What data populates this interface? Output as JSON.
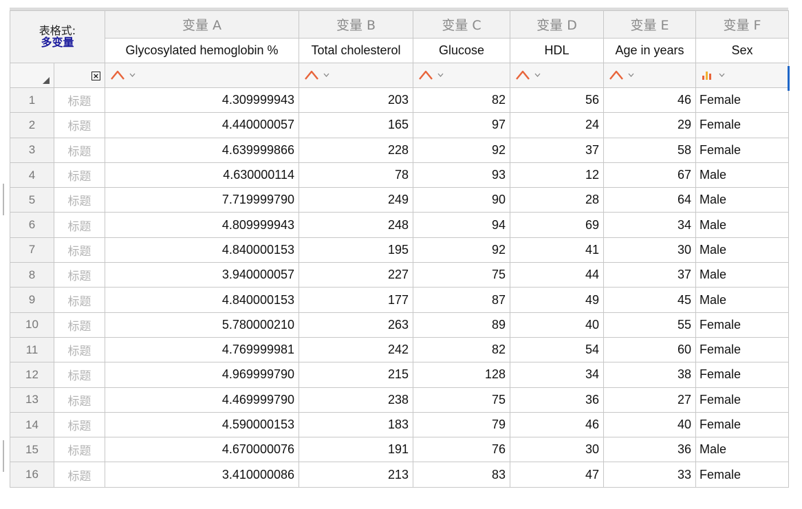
{
  "table_format": {
    "label": "表格式:",
    "value": "多变量"
  },
  "columns": [
    {
      "title": "变量 A",
      "name": "Glycosylated hemoglobin %",
      "type_icon": "continuous-distribution-icon"
    },
    {
      "title": "变量 B",
      "name": "Total cholesterol",
      "type_icon": "continuous-distribution-icon"
    },
    {
      "title": "变量 C",
      "name": "Glucose",
      "type_icon": "continuous-distribution-icon"
    },
    {
      "title": "变量 D",
      "name": "HDL",
      "type_icon": "continuous-distribution-icon"
    },
    {
      "title": "变量 E",
      "name": "Age in years",
      "type_icon": "continuous-distribution-icon"
    },
    {
      "title": "变量 F",
      "name": "Sex",
      "type_icon": "categorical-bar-icon"
    }
  ],
  "row_title_placeholder": "标题",
  "rows": [
    {
      "num": "1",
      "values": [
        "4.309999943",
        "203",
        "82",
        "56",
        "46",
        "Female"
      ]
    },
    {
      "num": "2",
      "values": [
        "4.440000057",
        "165",
        "97",
        "24",
        "29",
        "Female"
      ]
    },
    {
      "num": "3",
      "values": [
        "4.639999866",
        "228",
        "92",
        "37",
        "58",
        "Female"
      ]
    },
    {
      "num": "4",
      "values": [
        "4.630000114",
        "78",
        "93",
        "12",
        "67",
        "Male"
      ]
    },
    {
      "num": "5",
      "values": [
        "7.719999790",
        "249",
        "90",
        "28",
        "64",
        "Male"
      ]
    },
    {
      "num": "6",
      "values": [
        "4.809999943",
        "248",
        "94",
        "69",
        "34",
        "Male"
      ]
    },
    {
      "num": "7",
      "values": [
        "4.840000153",
        "195",
        "92",
        "41",
        "30",
        "Male"
      ]
    },
    {
      "num": "8",
      "values": [
        "3.940000057",
        "227",
        "75",
        "44",
        "37",
        "Male"
      ]
    },
    {
      "num": "9",
      "values": [
        "4.840000153",
        "177",
        "87",
        "49",
        "45",
        "Male"
      ]
    },
    {
      "num": "10",
      "values": [
        "5.780000210",
        "263",
        "89",
        "40",
        "55",
        "Female"
      ]
    },
    {
      "num": "11",
      "values": [
        "4.769999981",
        "242",
        "82",
        "54",
        "60",
        "Female"
      ]
    },
    {
      "num": "12",
      "values": [
        "4.969999790",
        "215",
        "128",
        "34",
        "38",
        "Female"
      ]
    },
    {
      "num": "13",
      "values": [
        "4.469999790",
        "238",
        "75",
        "36",
        "27",
        "Female"
      ]
    },
    {
      "num": "14",
      "values": [
        "4.590000153",
        "183",
        "79",
        "46",
        "40",
        "Female"
      ]
    },
    {
      "num": "15",
      "values": [
        "4.670000076",
        "191",
        "76",
        "30",
        "36",
        "Male"
      ]
    },
    {
      "num": "16",
      "values": [
        "3.410000086",
        "213",
        "83",
        "47",
        "33",
        "Female"
      ]
    }
  ],
  "colors": {
    "continuous_icon": "#e8643a",
    "categorical_icon_a": "#e8643a",
    "categorical_icon_b": "#f2b233",
    "format_value": "#1a1a9c",
    "column_header_text": "#8a8a8a",
    "selection_edge": "#1e66c8"
  }
}
